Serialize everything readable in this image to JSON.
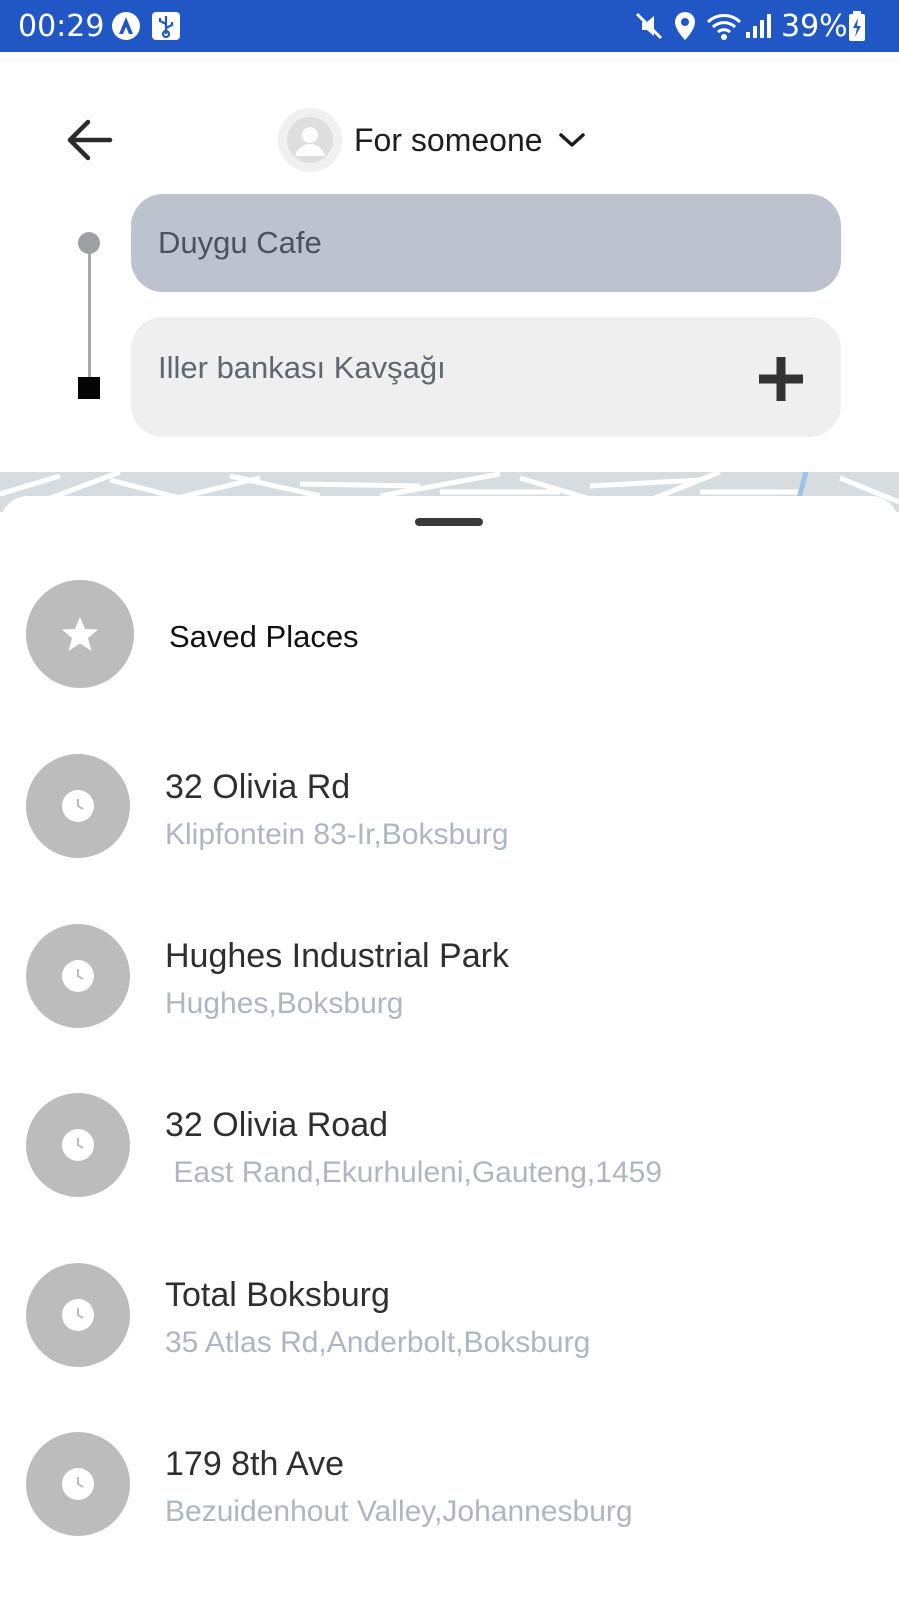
{
  "status_bar": {
    "time": "00:29",
    "battery_percent": "39%",
    "icons": [
      "android-auto-icon",
      "usb-icon",
      "mute-icon",
      "location-icon",
      "wifi-icon",
      "signal-icon",
      "battery-charging-icon"
    ]
  },
  "header": {
    "back_icon": "arrow-left-icon",
    "for_label": "For someone",
    "avatar_icon": "user-avatar-icon",
    "chevron_icon": "chevron-down-icon"
  },
  "route": {
    "origin": "Duygu Cafe",
    "destination": "Iller bankası Kavşağı",
    "add_stop_icon": "plus-icon"
  },
  "sheet": {
    "saved_places_label": "Saved Places",
    "saved_icon": "star-icon",
    "recent_icon": "clock-icon",
    "recent": [
      {
        "title": "32 Olivia Rd",
        "subtitle": "Klipfontein 83-Ir,Boksburg"
      },
      {
        "title": "Hughes Industrial Park",
        "subtitle": "Hughes,Boksburg"
      },
      {
        "title": "32 Olivia Road",
        "subtitle": " East Rand,Ekurhuleni,Gauteng,1459"
      },
      {
        "title": "Total Boksburg",
        "subtitle": "35 Atlas Rd,Anderbolt,Boksburg"
      },
      {
        "title": "179 8th Ave",
        "subtitle": "Bezuidenhout Valley,Johannesburg"
      }
    ]
  },
  "colors": {
    "status_bar": "#2157c4",
    "origin_field": "#bcc3ce",
    "destination_field": "#efefef",
    "icon_circle": "#bcbcbc",
    "subtitle_text": "#aeb6c3"
  }
}
